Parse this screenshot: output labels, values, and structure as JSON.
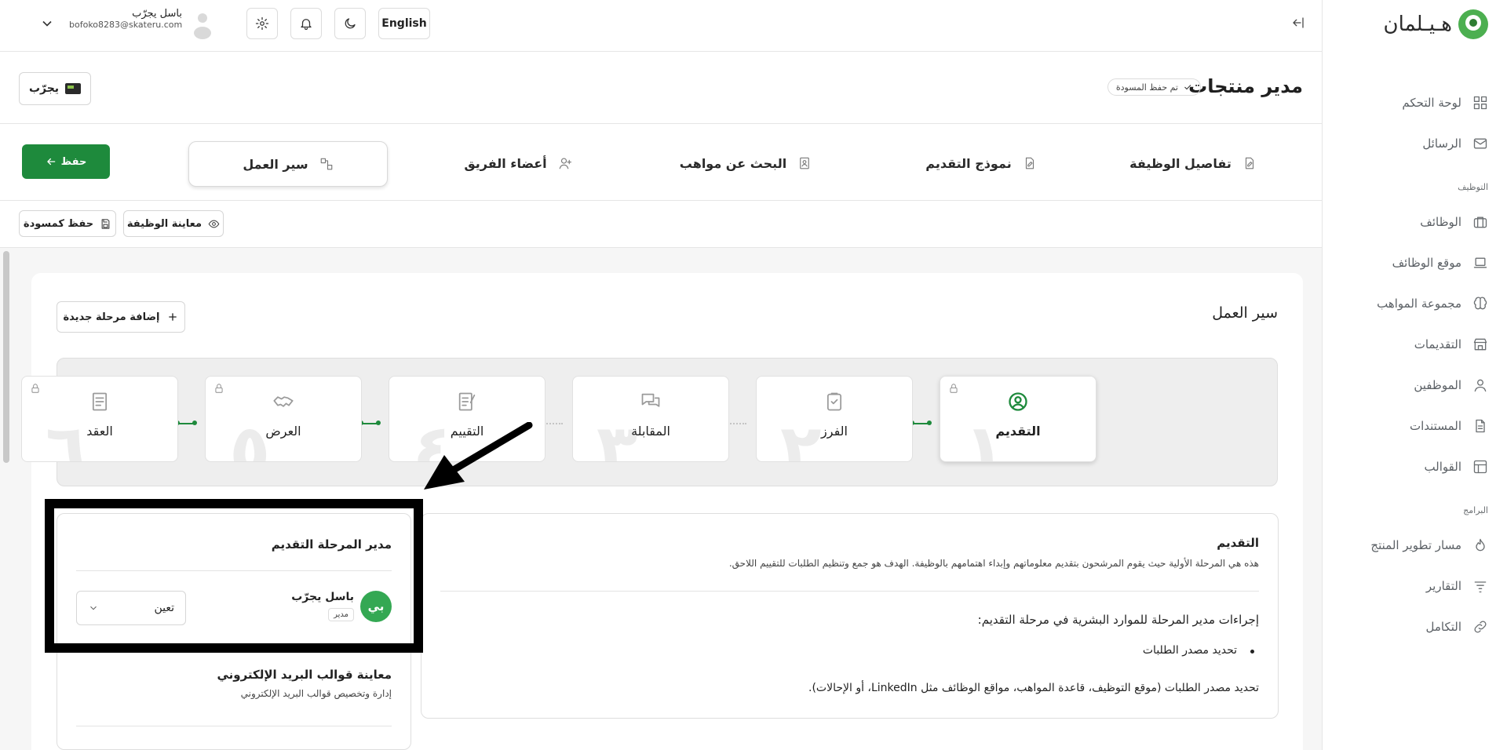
{
  "brand": {
    "name": "هـيـلمان",
    "accent": "#1e8a3c"
  },
  "user": {
    "name": "باسل يجرّب",
    "email": "bofoko8283@skateru.com"
  },
  "topbar": {
    "language": "English"
  },
  "sidebar": {
    "items": [
      {
        "label": "لوحة التحكم",
        "icon": "dashboard-icon"
      },
      {
        "label": "الرسائل",
        "icon": "mail-icon"
      }
    ],
    "section_hiring": "التوظيف",
    "hiring_items": [
      {
        "label": "الوظائف",
        "icon": "briefcase-icon"
      },
      {
        "label": "موقع الوظائف",
        "icon": "laptop-icon"
      },
      {
        "label": "مجموعة المواهب",
        "icon": "brain-icon"
      },
      {
        "label": "التقديمات",
        "icon": "store-icon"
      },
      {
        "label": "الموظفين",
        "icon": "user-icon"
      },
      {
        "label": "المستندات",
        "icon": "document-icon"
      },
      {
        "label": "القوالب",
        "icon": "template-icon"
      }
    ],
    "section_programs": "البرامج",
    "program_items": [
      {
        "label": "مسار تطوير المنتج",
        "icon": "flame-icon"
      },
      {
        "label": "التقارير",
        "icon": "filter-icon"
      },
      {
        "label": "التكامل",
        "icon": "link-icon"
      }
    ]
  },
  "header": {
    "title": "مدير منتجات",
    "draft_status": "تم حفظ المسودة",
    "test_label": "يجرّب"
  },
  "tabs": [
    {
      "label": "تفاصيل الوظيفة"
    },
    {
      "label": "نموذج التقديم"
    },
    {
      "label": "البحث عن مواهب"
    },
    {
      "label": "أعضاء الفريق"
    },
    {
      "label": "سير العمل"
    }
  ],
  "save_label": "حفظ",
  "actions": {
    "preview": "معاينة الوظيفة",
    "save_draft": "حفظ كمسودة"
  },
  "workflow": {
    "title": "سير العمل",
    "add_stage": "إضافة مرحلة جديدة",
    "stages": [
      {
        "label": "التقديم",
        "number": "١"
      },
      {
        "label": "الفرز",
        "number": "٢"
      },
      {
        "label": "المقابلة",
        "number": "٣"
      },
      {
        "label": "التقييم",
        "number": "٤"
      },
      {
        "label": "العرض",
        "number": "٥"
      },
      {
        "label": "العقد",
        "number": "٦"
      }
    ]
  },
  "stage_detail": {
    "title": "التقديم",
    "description": "هذه هي المرحلة الأولية حيث يقوم المرشحون بتقديم معلوماتهم وإبداء اهتمامهم بالوظيفة. الهدف هو جمع وتنظيم الطلبات للتقييم اللاحق.",
    "actions_title": "إجراءات مدير المرحلة للموارد البشرية في مرحلة التقديم:",
    "bullet": "تحديد مصدر الطلبات",
    "source_text": "تحديد مصدر الطلبات (موقع التوظيف، قاعدة المواهب، مواقع الوظائف مثل LinkedIn، أو الإحالات)."
  },
  "manager_panel": {
    "title": "مدير المرحلة التقديم",
    "manager_name": "باسل يجرّب",
    "manager_role": "مدير",
    "avatar_initial": "بي",
    "assign_label": "تعين",
    "email_title": "معاينة قوالب البريد الإلكتروني",
    "email_subtitle": "إدارة وتخصيص قوالب البريد الإلكتروني"
  }
}
